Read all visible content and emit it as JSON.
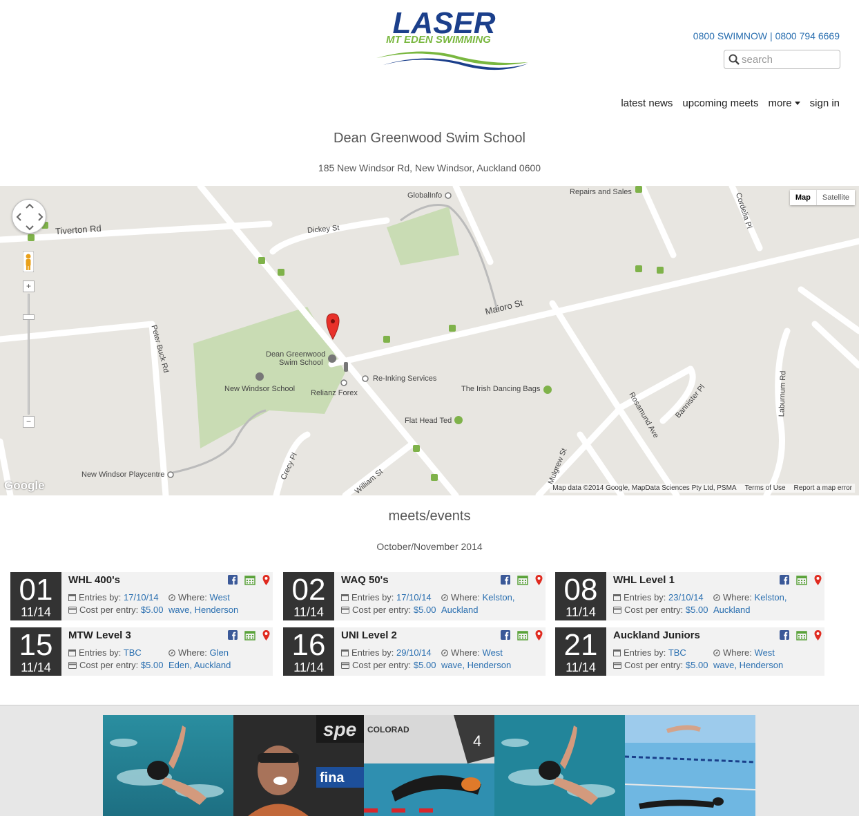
{
  "header": {
    "logo_text": "LASER",
    "logo_subtext": "MT EDEN SWIMMING",
    "phone": "0800 SWIMNOW | 0800 794 6669",
    "search_placeholder": "search"
  },
  "nav": {
    "items": [
      "latest news",
      "upcoming meets",
      "more",
      "sign in"
    ]
  },
  "venue": {
    "title": "Dean Greenwood Swim School",
    "address": "185 New Windsor Rd, New Windsor, Auckland 0600"
  },
  "map": {
    "type_buttons": [
      "Map",
      "Satellite"
    ],
    "labels": {
      "tiverton": "Tiverton Rd",
      "dickey": "Dickey St",
      "globalinfo": "GlobalInfo",
      "repairs": "Repairs and Sales",
      "maioro": "Maioro St",
      "peterbuck": "Peter Buck Rd",
      "dgss": "Dean Greenwood",
      "dgss2": "Swim School",
      "nws": "New Windsor School",
      "reinking": "Re-Inking Services",
      "relianz": "Relianz Forex",
      "irish": "The Irish Dancing Bags",
      "flathead": "Flat Head Ted",
      "rosamund": "Rosamund Ave",
      "bannister": "Bannister Pl",
      "laburnum": "Laburnum Rd",
      "cordelia": "Cordelia Pl",
      "playcentre": "New Windsor Playcentre",
      "crecy": "Crecy Pl",
      "william": "William St",
      "mulgrew": "Mulgrew St"
    },
    "footer": [
      "Map data ©2014 Google, MapData Sciences Pty Ltd, PSMA",
      "Terms of Use",
      "Report a map error"
    ],
    "google": "Google"
  },
  "meets": {
    "title": "meets/events",
    "period": "October/November 2014",
    "entries_label": "Entries by:",
    "where_label": "Where:",
    "cost_label": "Cost per entry:",
    "events": [
      {
        "day": "01",
        "month": "11/14",
        "name": "WHL 400's",
        "entries": "17/10/14",
        "where1": "West",
        "where2": "wave, Henderson",
        "cost": "$5.00"
      },
      {
        "day": "02",
        "month": "11/14",
        "name": "WAQ 50's",
        "entries": "17/10/14",
        "where1": "Kelston,",
        "where2": "Auckland",
        "cost": "$5.00"
      },
      {
        "day": "08",
        "month": "11/14",
        "name": "WHL Level 1",
        "entries": "23/10/14",
        "where1": "Kelston,",
        "where2": "Auckland",
        "cost": "$5.00"
      },
      {
        "day": "15",
        "month": "11/14",
        "name": "MTW Level 3",
        "entries": "TBC",
        "where1": "Glen",
        "where2": "Eden, Auckland",
        "cost": "$5.00"
      },
      {
        "day": "16",
        "month": "11/14",
        "name": "UNI Level 2",
        "entries": "29/10/14",
        "where1": "West",
        "where2": "wave, Henderson",
        "cost": "$5.00"
      },
      {
        "day": "21",
        "month": "11/14",
        "name": "Auckland Juniors",
        "entries": "TBC",
        "where1": "West",
        "where2": "wave, Henderson",
        "cost": "$5.00"
      }
    ]
  },
  "gallery": {
    "photo_text": [
      "spe",
      "fina",
      "COLORAD",
      "4"
    ]
  },
  "colors": {
    "brand_blue": "#1b3f8b",
    "brand_green": "#79b73f",
    "link_blue": "#2a6fb0",
    "date_bg": "#333333"
  }
}
